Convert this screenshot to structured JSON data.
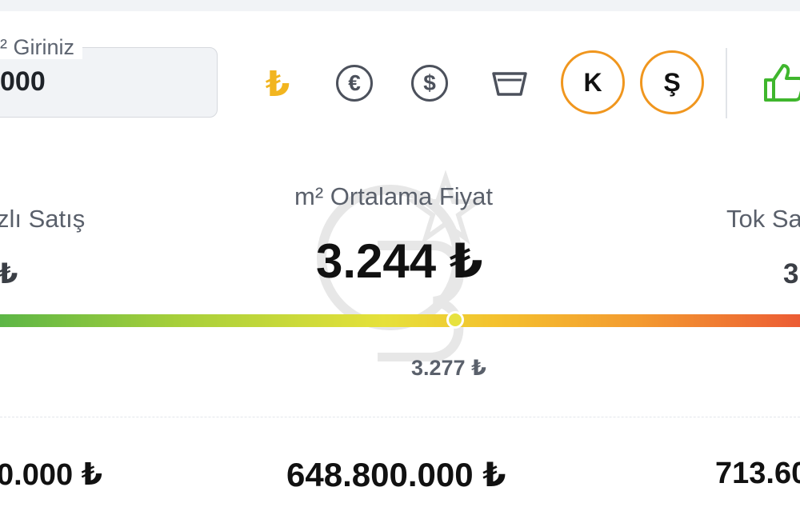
{
  "input": {
    "legend": "² Giriniz",
    "value": "000"
  },
  "toolbar": {
    "icons": [
      "turkish-lira-icon",
      "euro-icon",
      "dollar-icon",
      "basket-icon",
      "thumbs-up-icon"
    ],
    "euro_symbol": "€",
    "dollar_symbol": "$",
    "lira_symbol": "₺",
    "k_label": "K",
    "s_label": "Ş",
    "colors": {
      "lira": "#f2b51f",
      "accent": "#f0961e",
      "like": "#3fb62d"
    }
  },
  "stats": {
    "left_label": "zlı Satış",
    "left_value": "₺",
    "center_label": "m² Ortalama Fiyat",
    "center_value": "3.244 ₺",
    "right_label": "Tok Sa",
    "right_value": "3",
    "marker_value": "3.277 ₺"
  },
  "totals": {
    "left": "0.000 ₺",
    "center": "648.800.000 ₺",
    "right": "713.60"
  }
}
